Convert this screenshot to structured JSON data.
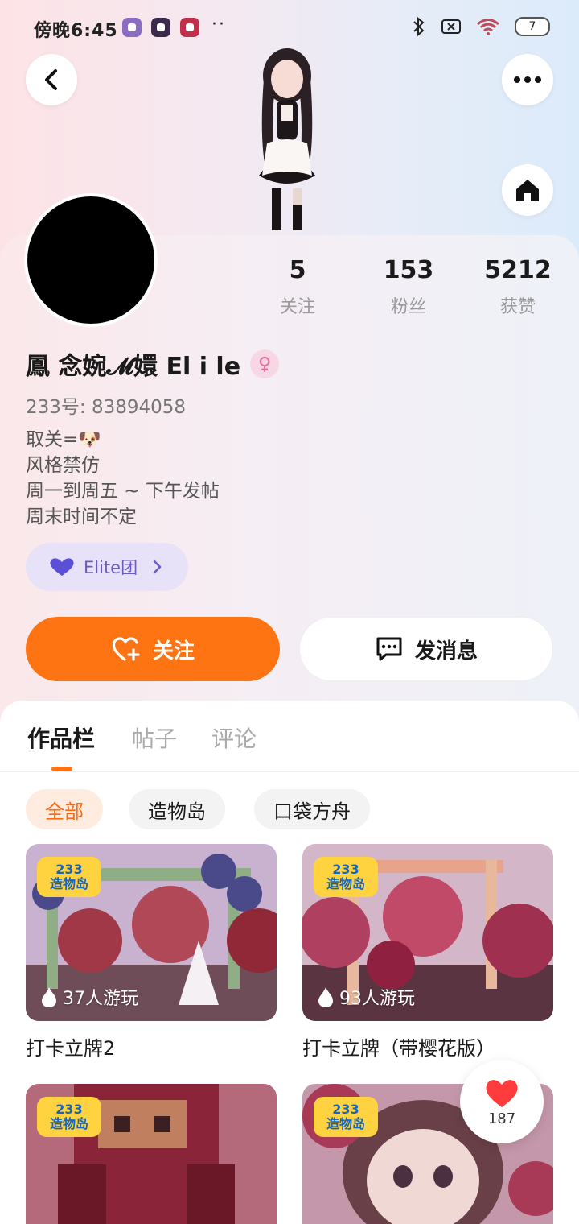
{
  "status_bar": {
    "time": "傍晚6:45",
    "more_dots": "··",
    "battery": "7"
  },
  "profile": {
    "stats": [
      {
        "value": "5",
        "label": "关注"
      },
      {
        "value": "153",
        "label": "粉丝"
      },
      {
        "value": "5212",
        "label": "获赞"
      }
    ],
    "name": "鳳 念婉𝓜嬛 El i le",
    "gender_icon": "female-icon",
    "uid": "233号: 83894058",
    "bio": [
      "取关=🐶",
      "风格禁仿",
      "周一到周五 ~ 下午发帖",
      "周末时间不定"
    ],
    "elite_label": "Elite团",
    "follow_label": "关注",
    "message_label": "发消息"
  },
  "tabs": [
    "作品栏",
    "帖子",
    "评论"
  ],
  "filters": [
    "全部",
    "造物岛",
    "口袋方舟"
  ],
  "games": [
    {
      "badge_top": "233",
      "badge_bottom": "造物岛",
      "players": "37人游玩",
      "title": "打卡立牌2",
      "palette": [
        "#b9a3c8",
        "#9c6a7c",
        "#5e3a44"
      ]
    },
    {
      "badge_top": "233",
      "badge_bottom": "造物岛",
      "players": "93人游玩",
      "title": "打卡立牌（带樱花版）",
      "palette": [
        "#c9a3b8",
        "#b35668",
        "#6a2e3c"
      ]
    },
    {
      "badge_top": "233",
      "badge_bottom": "造物岛",
      "players": "",
      "title": "",
      "palette": [
        "#c07a88",
        "#9a3048",
        "#5a1e2a"
      ]
    },
    {
      "badge_top": "233",
      "badge_bottom": "造物岛",
      "players": "",
      "title": "",
      "palette": [
        "#d6b4c4",
        "#a55068",
        "#4a2a34"
      ]
    }
  ],
  "like": {
    "count": "187"
  },
  "colors": {
    "accent": "#ff7412",
    "elite": "#6a5bc9"
  }
}
